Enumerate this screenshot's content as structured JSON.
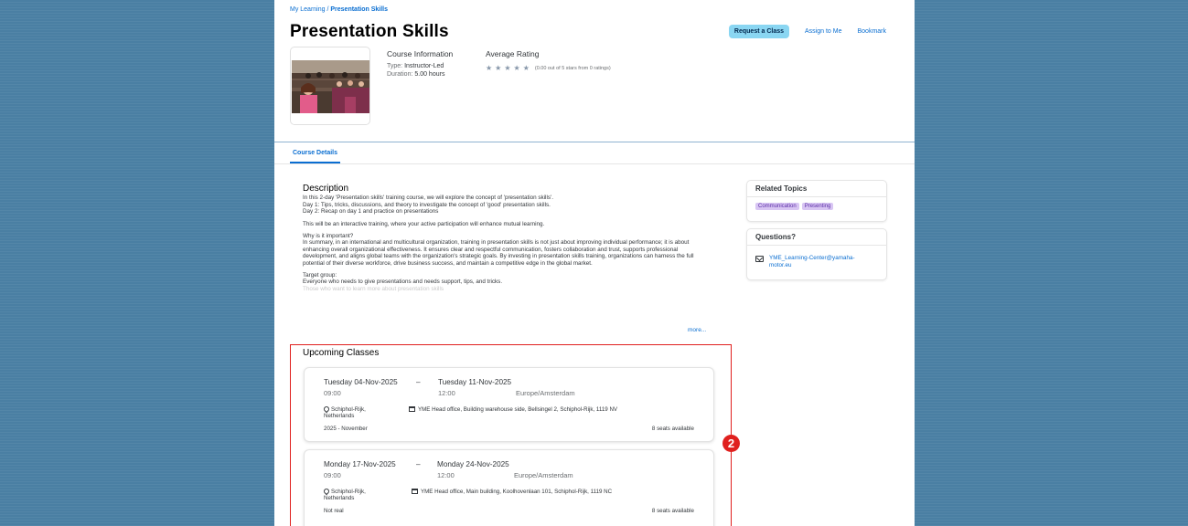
{
  "breadcrumb": {
    "parent": "My Learning",
    "separator": " / ",
    "current": "Presentation Skills"
  },
  "title": "Presentation Skills",
  "actions": {
    "request": "Request a Class",
    "assign": "Assign to Me",
    "bookmark": "Bookmark"
  },
  "course_info": {
    "heading": "Course Information",
    "type_label": "Type:",
    "type_value": "Instructor-Led",
    "duration_label": "Duration:",
    "duration_value": "5.00 hours"
  },
  "rating": {
    "heading": "Average Rating",
    "text": "(0.00 out of 5 stars from 0 ratings)"
  },
  "tabs": [
    {
      "label": "Course Details"
    }
  ],
  "description": {
    "heading": "Description",
    "p1": [
      "In this 2-day 'Presentation skills' training course, we will explore the concept of 'presentation skills'.",
      "Day 1: Tips, tricks, discussions, and theory to investigate the concept of 'good' presentation skills.",
      "Day 2: Recap on day 1 and practice on presentations"
    ],
    "p2": "This will be an interactive training, where your active participation will enhance mutual learning.",
    "p3_head": "Why is it important?",
    "p3": "In summary, in an international and multicultural organization, training in presentation skills is not just about improving individual performance; it is about enhancing overall organizational effectiveness. It ensures clear and respectful communication, fosters collaboration and trust, supports professional development, and aligns global teams with the organization's strategic goals. By investing in presentation skills training, organizations can harness the full potential of their diverse workforce, drive business success, and maintain a competitive edge in the global market.",
    "p4_head": "Target group:",
    "p4": "Everyone who needs to give presentations and needs support, tips, and tricks.",
    "p4_faded": "Those who want to learn more about presentation skills",
    "more": "more..."
  },
  "related": {
    "heading": "Related Topics",
    "tags": [
      "Communication",
      "Presenting"
    ]
  },
  "questions": {
    "heading": "Questions?",
    "email": "YME_Learning-Center@yamaha-motor.eu"
  },
  "upcoming": {
    "heading": "Upcoming Classes",
    "classes": [
      {
        "start_date": "Tuesday 04-Nov-2025",
        "dash": "–",
        "end_date": "Tuesday 11-Nov-2025",
        "start_time": "09:00",
        "end_time": "12:00",
        "timezone": "Europe/Amsterdam",
        "city": "Schiphol-Rijk, Netherlands",
        "venue": "YME Head office, Building warehouse side, Bellsingel 2, Schiphol-Rijk, 1119 NV",
        "note": "2025 - November",
        "seats": "8 seats available"
      },
      {
        "start_date": "Monday 17-Nov-2025",
        "dash": "–",
        "end_date": "Monday 24-Nov-2025",
        "start_time": "09:00",
        "end_time": "12:00",
        "timezone": "Europe/Amsterdam",
        "city": "Schiphol-Rijk, Netherlands",
        "venue": "YME Head office, Main building, Koolhovenlaan 101, Schiphol-Rijk, 1119 NC",
        "note": "Not real",
        "seats": "8 seats available"
      }
    ]
  },
  "annotation_badge": "2",
  "colors": {
    "accent": "#0a6ed1",
    "primary_button": "#8ad6f2",
    "highlight": "#e0201e",
    "tag_bg": "#d8c5f3",
    "backdrop": "#4a7fa3"
  },
  "icons": {
    "location": "location-pin-icon",
    "building": "building-icon",
    "email": "email-icon",
    "star": "star-icon"
  }
}
